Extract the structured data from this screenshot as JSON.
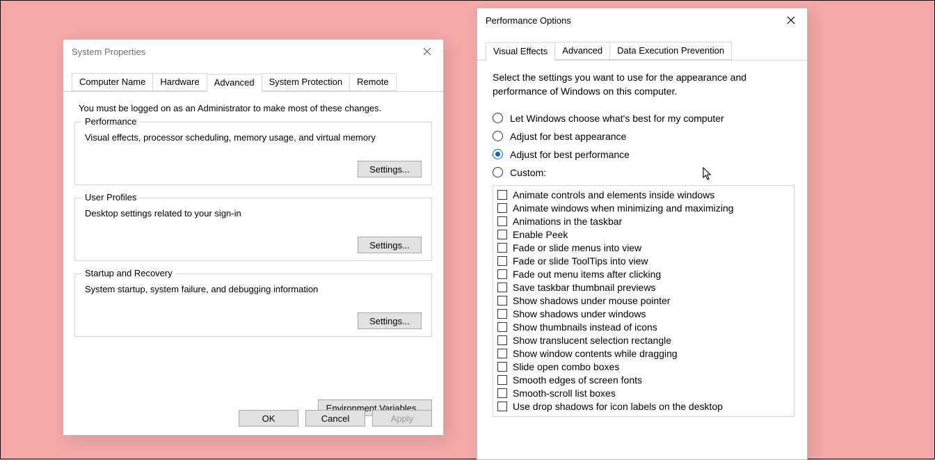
{
  "win1": {
    "title": "System Properties",
    "tabs": [
      "Computer Name",
      "Hardware",
      "Advanced",
      "System Protection",
      "Remote"
    ],
    "active_tab_index": 2,
    "admin_note": "You must be logged on as an Administrator to make most of these changes.",
    "groups": {
      "performance": {
        "legend": "Performance",
        "desc": "Visual effects, processor scheduling, memory usage, and virtual memory",
        "button": "Settings..."
      },
      "user_profiles": {
        "legend": "User Profiles",
        "desc": "Desktop settings related to your sign-in",
        "button": "Settings..."
      },
      "startup": {
        "legend": "Startup and Recovery",
        "desc": "System startup, system failure, and debugging information",
        "button": "Settings..."
      }
    },
    "env_button": "Environment Variables...",
    "buttons": {
      "ok": "OK",
      "cancel": "Cancel",
      "apply": "Apply"
    }
  },
  "win2": {
    "title": "Performance Options",
    "tabs": [
      "Visual Effects",
      "Advanced",
      "Data Execution Prevention"
    ],
    "active_tab_index": 0,
    "instruction": "Select the settings you want to use for the appearance and performance of Windows on this computer.",
    "radios": [
      "Let Windows choose what's best for my computer",
      "Adjust for best appearance",
      "Adjust for best performance",
      "Custom:"
    ],
    "selected_radio_index": 2,
    "checks": [
      "Animate controls and elements inside windows",
      "Animate windows when minimizing and maximizing",
      "Animations in the taskbar",
      "Enable Peek",
      "Fade or slide menus into view",
      "Fade or slide ToolTips into view",
      "Fade out menu items after clicking",
      "Save taskbar thumbnail previews",
      "Show shadows under mouse pointer",
      "Show shadows under windows",
      "Show thumbnails instead of icons",
      "Show translucent selection rectangle",
      "Show window contents while dragging",
      "Slide open combo boxes",
      "Smooth edges of screen fonts",
      "Smooth-scroll list boxes",
      "Use drop shadows for icon labels on the desktop"
    ]
  }
}
